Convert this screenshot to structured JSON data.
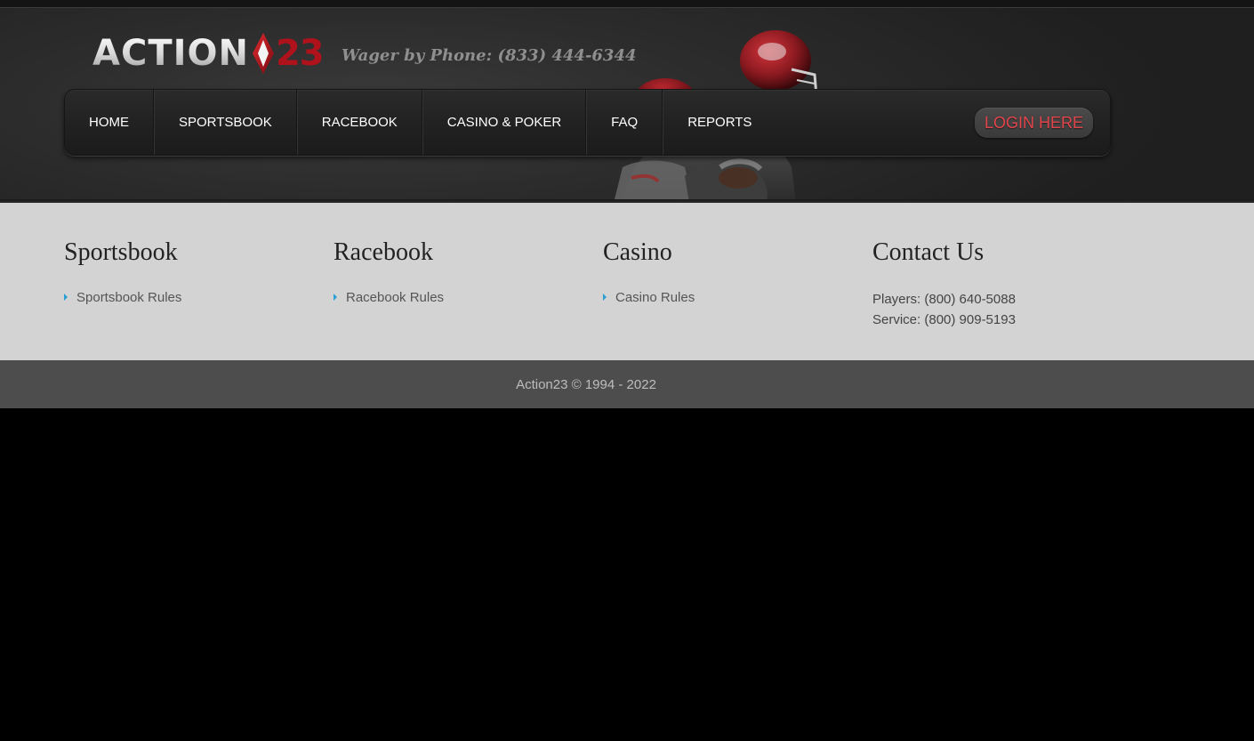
{
  "header": {
    "logo_text": "ACTION",
    "logo_number": "23",
    "phone": "Wager by Phone: (833) 444-6344",
    "colors": {
      "logo_red": "#b0121c",
      "login_red": "#e1444b",
      "helmet_red": "#8b1a20"
    }
  },
  "nav": {
    "items": [
      {
        "label": "HOME"
      },
      {
        "label": "SPORTSBOOK"
      },
      {
        "label": "RACEBOOK"
      },
      {
        "label": "CASINO & POKER"
      },
      {
        "label": "FAQ"
      },
      {
        "label": "REPORTS"
      }
    ],
    "login_label": "LOGIN HERE"
  },
  "footer": {
    "columns": [
      {
        "title": "Sportsbook",
        "links": [
          "Sportsbook Rules"
        ]
      },
      {
        "title": "Racebook",
        "links": [
          "Racebook Rules"
        ]
      },
      {
        "title": "Casino",
        "links": [
          "Casino Rules"
        ]
      }
    ],
    "contact": {
      "title": "Contact Us",
      "players": "Players: (800) 640-5088",
      "service": "Service: (800) 909-5193"
    },
    "bullet_color": "#2a9fd6",
    "copyright": "Action23 © 1994 - 2022"
  }
}
